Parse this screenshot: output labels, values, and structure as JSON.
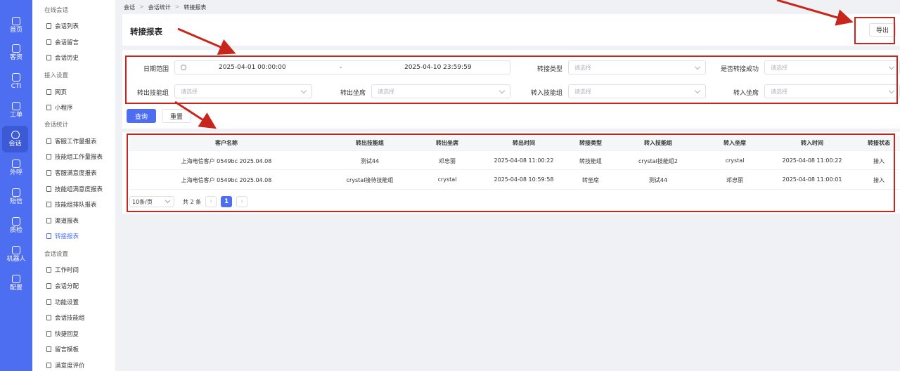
{
  "rail": [
    {
      "label": "首页",
      "icon": "home-icon"
    },
    {
      "label": "客资",
      "icon": "users-icon"
    },
    {
      "label": "CTI",
      "icon": "cti-icon"
    },
    {
      "label": "工单",
      "icon": "ticket-icon"
    },
    {
      "label": "会话",
      "icon": "chat-icon",
      "active": true
    },
    {
      "label": "外呼",
      "icon": "phone-icon"
    },
    {
      "label": "短信",
      "icon": "sms-icon"
    },
    {
      "label": "质检",
      "icon": "qc-icon"
    },
    {
      "label": "机器人",
      "icon": "robot-icon"
    },
    {
      "label": "配置",
      "icon": "settings-icon"
    }
  ],
  "menu": {
    "groups": [
      "在线会话",
      "接入设置",
      "会话统计",
      "会话设置"
    ],
    "items": [
      "会话列表",
      "会话留言",
      "会话历史",
      "网页",
      "小程序",
      "客服工作量报表",
      "技能组工作量报表",
      "客服满意度报表",
      "技能组满意度报表",
      "技能组排队报表",
      "渠道报表",
      "转接报表",
      "工作时间",
      "会话分配",
      "功能设置",
      "会话技能组",
      "快捷回复",
      "留言模板",
      "满意度评价"
    ]
  },
  "breadcrumb": [
    "会话",
    "会话统计",
    "转接报表"
  ],
  "page": {
    "title": "转接报表",
    "export_label": "导出"
  },
  "filters": {
    "date_label": "日期范围",
    "date_start": "2025-04-01 00:00:00",
    "date_sep": "-",
    "date_end": "2025-04-10 23:59:59",
    "transfer_type_label": "转接类型",
    "success_label": "是否转接成功",
    "out_group_label": "转出技能组",
    "out_agent_label": "转出坐席",
    "in_group_label": "转入技能组",
    "in_agent_label": "转入坐席",
    "placeholder": "请选择",
    "query_label": "查询",
    "reset_label": "重置"
  },
  "table": {
    "headers": [
      "客户名称",
      "转出技能组",
      "转出坐席",
      "转出时间",
      "转接类型",
      "转入技能组",
      "转入坐席",
      "转入时间",
      "转接状态"
    ],
    "rows": [
      [
        "上海电信客户 0549bc 2025.04.08",
        "测试44",
        "邓忠丽",
        "2025-04-08 11:00:22",
        "转技能组",
        "crystal技能组2",
        "crystal",
        "2025-04-08 11:00:22",
        "接入"
      ],
      [
        "上海电信客户 0549bc 2025.04.08",
        "crystal接待技能组",
        "crystal",
        "2025-04-08 10:59:58",
        "转坐席",
        "测试44",
        "邓忠丽",
        "2025-04-08 11:00:01",
        "接入"
      ]
    ]
  },
  "pager": {
    "page_size": "10条/页",
    "total": "共 2 条",
    "prev": "‹",
    "current": "1",
    "next": "›"
  },
  "colors": {
    "brand": "#4e6ef2",
    "annotation": "#c8261c"
  }
}
